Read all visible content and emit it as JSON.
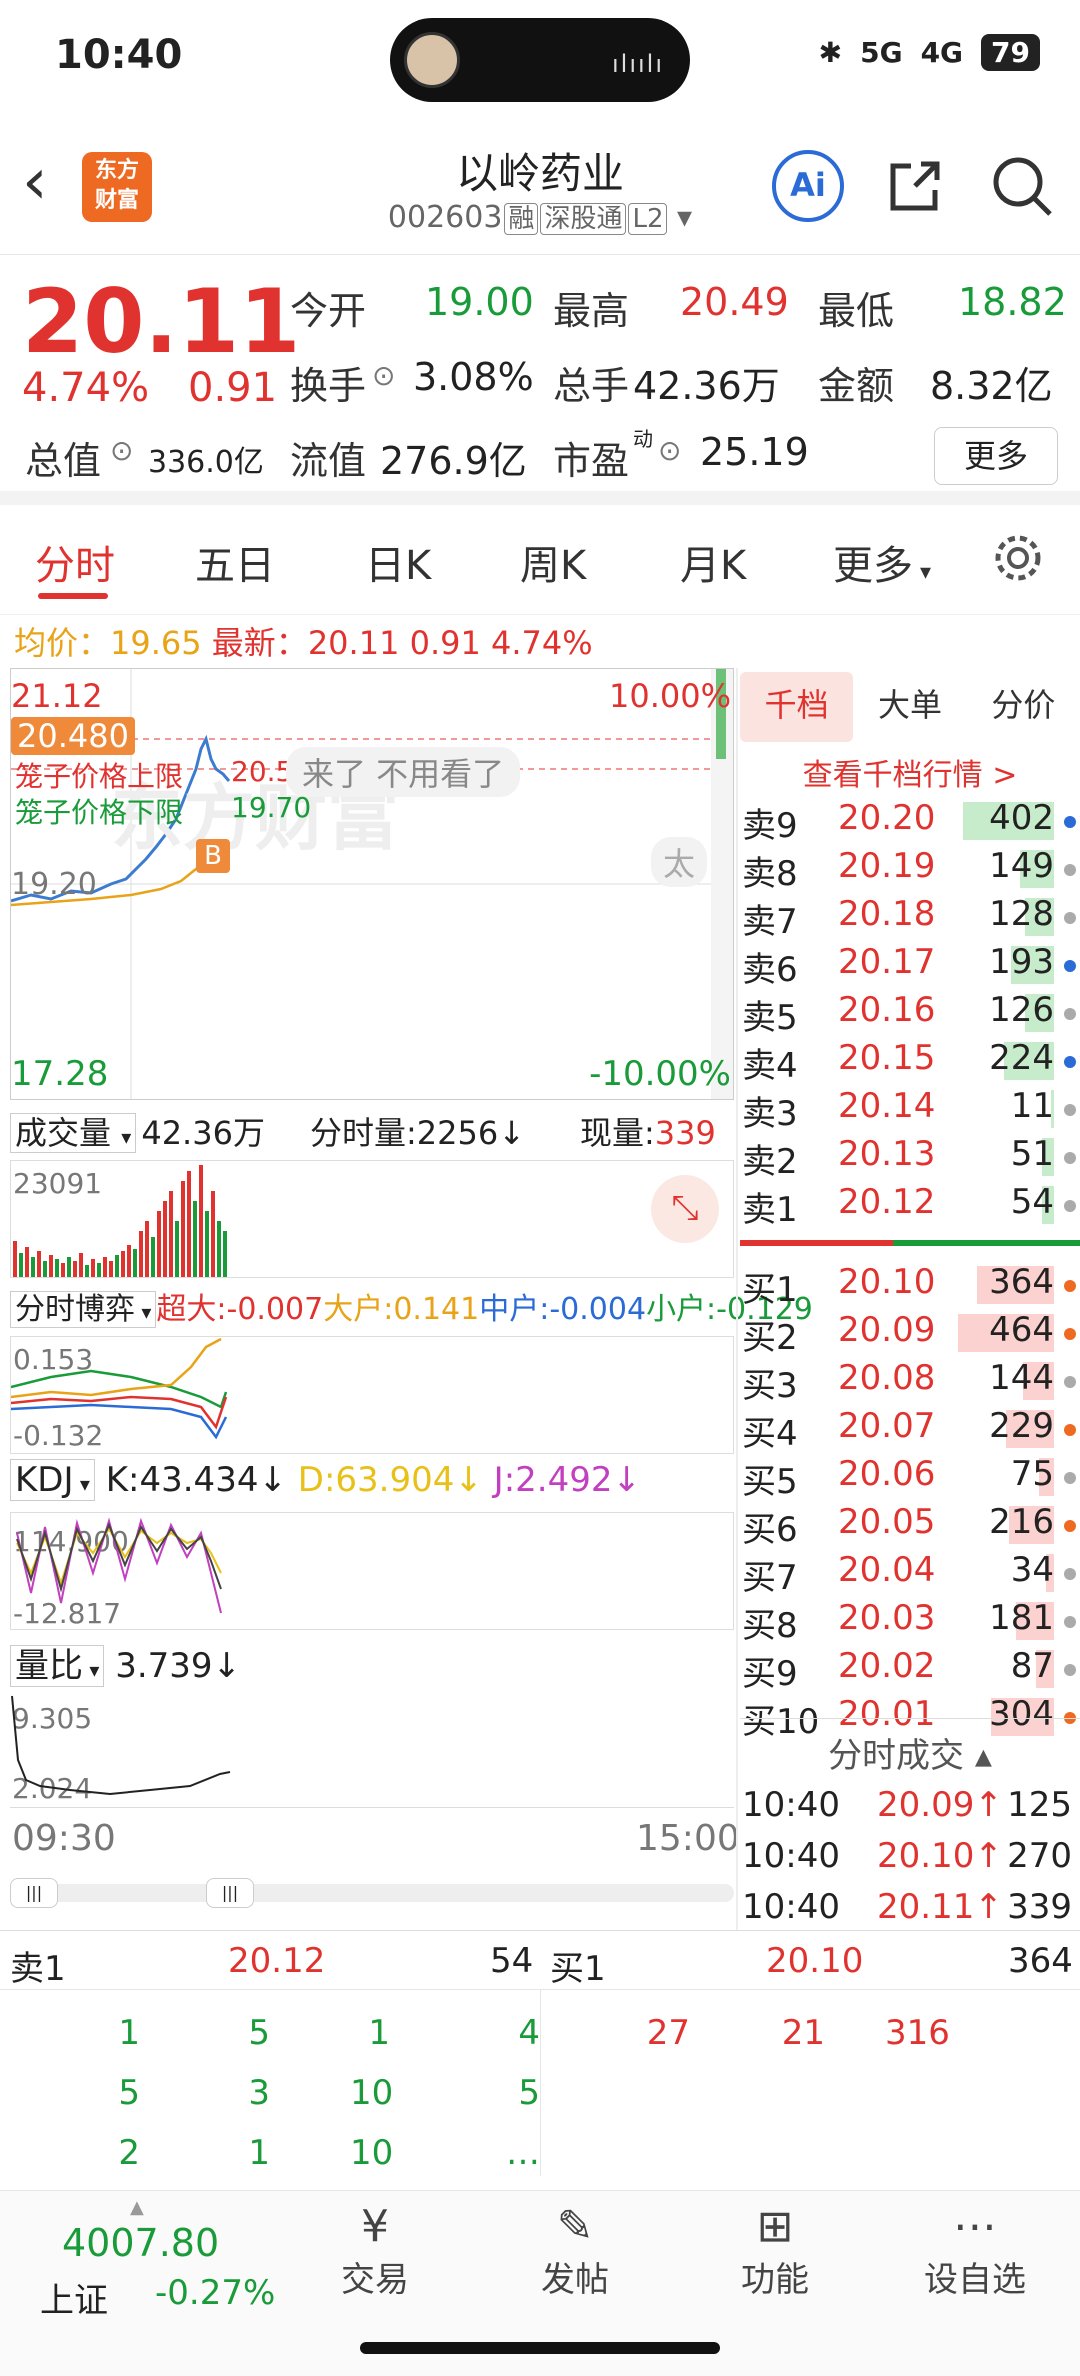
{
  "status": {
    "time": "10:40",
    "signal1": "5G",
    "signal2": "4G",
    "battery": "79"
  },
  "header": {
    "title": "以岭药业",
    "code": "002603",
    "tags": [
      "融",
      "深股通",
      "L2"
    ],
    "logo_text": "东方财富"
  },
  "quote": {
    "price": "20.11",
    "pct": "4.74%",
    "chg": "0.91",
    "open_label": "今开",
    "open": "19.00",
    "high_label": "最高",
    "high": "20.49",
    "low_label": "最低",
    "low": "18.82",
    "turnover_label": "换手",
    "turnover": "3.08%",
    "volume_label": "总手",
    "volume": "42.36万",
    "amount_label": "金额",
    "amount": "8.32亿",
    "mktcap_label": "总值",
    "mktcap": "336.0亿",
    "float_label": "流值",
    "float": "276.9亿",
    "pe_label": "市盈",
    "pe_sup": "动",
    "pe": "25.19",
    "more": "更多"
  },
  "tabs": [
    "分时",
    "五日",
    "日K",
    "周K",
    "月K",
    "更多"
  ],
  "chart": {
    "avg_label": "均价：",
    "avg": "19.65",
    "latest_label": "最新：",
    "latest": "20.11",
    "latest_chg": "0.91",
    "latest_pct": "4.74%",
    "top_price": "21.12",
    "top_pct": "10.00%",
    "bottom_price": "17.28",
    "bottom_pct": "-10.00%",
    "marker": "20.480",
    "cage_up": "笼子价格上限",
    "cage_up_val": "20.52",
    "cage_down": "笼子价格下限",
    "cage_down_val": "19.70",
    "mid_price": "19.20",
    "comment": "来了 不用看了",
    "b_badge": "B",
    "watermark": "东方财富",
    "side_label": "太",
    "start": "09:30",
    "end": "15:00"
  },
  "volume_panel": {
    "label": "成交量",
    "total": "42.36万",
    "tick_label": "分时量:",
    "tick": "2256↓",
    "now_label": "现量:",
    "now": "339",
    "max": "23091"
  },
  "game_panel": {
    "label": "分时博弈",
    "s1": "超大:-0.007",
    "s2": "大户:0.141",
    "s3": "中户:-0.004",
    "s4": "小户:-0.129",
    "max": "0.153",
    "min": "-0.132"
  },
  "kdj_panel": {
    "label": "KDJ",
    "k": "K:43.434↓",
    "d": "D:63.904↓",
    "j": "J:2.492↓",
    "max": "114.900",
    "min": "-12.817"
  },
  "lb_panel": {
    "label": "量比",
    "value": "3.739↓",
    "max": "9.305",
    "min": "2.024"
  },
  "side": {
    "tabs": [
      "千档",
      "大单",
      "分价"
    ],
    "link": "查看千档行情 >",
    "asks": [
      {
        "l": "卖9",
        "p": "20.20",
        "v": "402",
        "w": 0.95
      },
      {
        "l": "卖8",
        "p": "20.19",
        "v": "149",
        "w": 0.35
      },
      {
        "l": "卖7",
        "p": "20.18",
        "v": "128",
        "w": 0.3
      },
      {
        "l": "卖6",
        "p": "20.17",
        "v": "193",
        "w": 0.45
      },
      {
        "l": "卖5",
        "p": "20.16",
        "v": "126",
        "w": 0.3
      },
      {
        "l": "卖4",
        "p": "20.15",
        "v": "224",
        "w": 0.52
      },
      {
        "l": "卖3",
        "p": "20.14",
        "v": "11",
        "w": 0.03
      },
      {
        "l": "卖2",
        "p": "20.13",
        "v": "51",
        "w": 0.12
      },
      {
        "l": "卖1",
        "p": "20.12",
        "v": "54",
        "w": 0.13
      }
    ],
    "bids": [
      {
        "l": "买1",
        "p": "20.10",
        "v": "364",
        "w": 0.8
      },
      {
        "l": "买2",
        "p": "20.09",
        "v": "464",
        "w": 1.0
      },
      {
        "l": "买3",
        "p": "20.08",
        "v": "144",
        "w": 0.32
      },
      {
        "l": "买4",
        "p": "20.07",
        "v": "229",
        "w": 0.5
      },
      {
        "l": "买5",
        "p": "20.06",
        "v": "75",
        "w": 0.16
      },
      {
        "l": "买6",
        "p": "20.05",
        "v": "216",
        "w": 0.47
      },
      {
        "l": "买7",
        "p": "20.04",
        "v": "34",
        "w": 0.08
      },
      {
        "l": "买8",
        "p": "20.03",
        "v": "181",
        "w": 0.4
      },
      {
        "l": "买9",
        "p": "20.02",
        "v": "87",
        "w": 0.19
      },
      {
        "l": "买10",
        "p": "20.01",
        "v": "304",
        "w": 0.66
      }
    ],
    "trades_title": "分时成交",
    "trades": [
      {
        "t": "10:40",
        "p": "20.09↑",
        "v": "125"
      },
      {
        "t": "10:40",
        "p": "20.10↑",
        "v": "270"
      },
      {
        "t": "10:40",
        "p": "20.11↑",
        "v": "339"
      }
    ]
  },
  "bottom": {
    "sell_label": "卖1",
    "sell_price": "20.12",
    "sell_vol": "54",
    "buy_label": "买1",
    "buy_price": "20.10",
    "buy_vol": "364",
    "sell_orders": [
      [
        "1",
        "5",
        "1",
        "4"
      ],
      [
        "5",
        "3",
        "10",
        "5"
      ],
      [
        "2",
        "1",
        "10",
        "…"
      ]
    ],
    "buy_orders": [
      "27",
      "21",
      "316"
    ]
  },
  "nav": {
    "index_value": "4007.80",
    "index_name": "上证",
    "index_chg": "-0.27%",
    "items": [
      "交易",
      "发帖",
      "功能",
      "设自选"
    ]
  }
}
